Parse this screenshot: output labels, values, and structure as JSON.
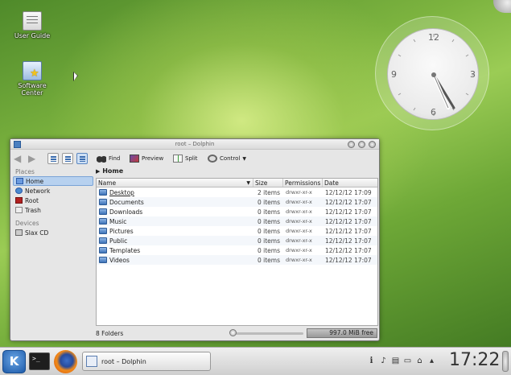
{
  "desktop": {
    "icons": [
      {
        "label": "User Guide"
      },
      {
        "label": "Software Center"
      }
    ]
  },
  "clock": {
    "numbers": {
      "n12": "12",
      "n3": "3",
      "n6": "6",
      "n9": "9"
    }
  },
  "window": {
    "title": "root – Dolphin",
    "toolbar": {
      "find": "Find",
      "preview": "Preview",
      "split": "Split",
      "control": "Control"
    },
    "places": {
      "header": "Places",
      "items": [
        {
          "label": "Home",
          "selected": true
        },
        {
          "label": "Network"
        },
        {
          "label": "Root"
        },
        {
          "label": "Trash"
        }
      ],
      "devices_header": "Devices",
      "devices": [
        {
          "label": "Slax CD"
        }
      ]
    },
    "breadcrumb": "Home",
    "columns": {
      "name": "Name",
      "size": "Size",
      "permissions": "Permissions",
      "date": "Date"
    },
    "rows": [
      {
        "name": "Desktop",
        "size": "2 items",
        "perm": "drwxr-xr-x",
        "date": "12/12/12 17:09"
      },
      {
        "name": "Documents",
        "size": "0 items",
        "perm": "drwxr-xr-x",
        "date": "12/12/12 17:07"
      },
      {
        "name": "Downloads",
        "size": "0 items",
        "perm": "drwxr-xr-x",
        "date": "12/12/12 17:07"
      },
      {
        "name": "Music",
        "size": "0 items",
        "perm": "drwxr-xr-x",
        "date": "12/12/12 17:07"
      },
      {
        "name": "Pictures",
        "size": "0 items",
        "perm": "drwxr-xr-x",
        "date": "12/12/12 17:07"
      },
      {
        "name": "Public",
        "size": "0 items",
        "perm": "drwxr-xr-x",
        "date": "12/12/12 17:07"
      },
      {
        "name": "Templates",
        "size": "0 items",
        "perm": "drwxr-xr-x",
        "date": "12/12/12 17:07"
      },
      {
        "name": "Videos",
        "size": "0 items",
        "perm": "drwxr-xr-x",
        "date": "12/12/12 17:07"
      }
    ],
    "status": {
      "summary": "8 Folders",
      "free_space": "997.0 MiB free"
    }
  },
  "panel": {
    "task": "root – Dolphin",
    "time": "17:22"
  }
}
